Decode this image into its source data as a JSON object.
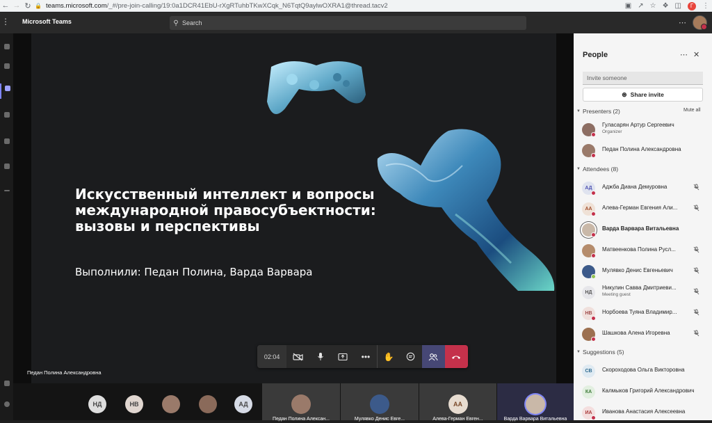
{
  "browser": {
    "url_host": "teams.microsoft.com",
    "url_path": "/_#/pre-join-calling/19:0a1DCR41EbU-rXgRTuhbTKwXCqk_N6TqtQ9aylwOXRA1@thread.tacv2",
    "profile_letter": "Г"
  },
  "teams": {
    "app_title": "Microsoft Teams",
    "search_placeholder": "Search"
  },
  "left_rail": [
    {
      "label": "Activity",
      "icon": "bell-icon"
    },
    {
      "label": "Chat",
      "icon": "chat-icon"
    },
    {
      "label": "Teams",
      "icon": "teams-icon",
      "active": true
    },
    {
      "label": "Assignments",
      "icon": "assignments-icon"
    },
    {
      "label": "Calendar",
      "icon": "calendar-icon"
    },
    {
      "label": "Calls",
      "icon": "phone-icon"
    },
    {
      "label": "...",
      "icon": "more-icon"
    }
  ],
  "slide": {
    "title": "Искусственный интеллект и вопросы международной правосубъектности: вызовы и перспективы",
    "subtitle": "Выполнили: Педан Полина, Варда Варвара"
  },
  "presenter_name": "Педан Полина Александровна",
  "call_controls": {
    "timer": "02:04",
    "buttons": [
      "camera-off-icon",
      "microphone-icon",
      "share-screen-icon",
      "more-icon",
      "raise-hand-icon",
      "chat-icon",
      "people-icon",
      "hang-up-icon"
    ]
  },
  "tiles": {
    "avatars": [
      {
        "initials": "НД",
        "bg": "#dedede",
        "fg": "#444"
      },
      {
        "initials": "НВ",
        "bg": "#e0d6d0",
        "fg": "#444"
      },
      {
        "initials": "",
        "bg": "#9a7a6a",
        "fg": "#fff"
      },
      {
        "initials": "",
        "bg": "#8a6a5a",
        "fg": "#fff"
      },
      {
        "initials": "АД",
        "bg": "#d6dbe6",
        "fg": "#444"
      }
    ],
    "video_tiles": [
      {
        "name": "Педан Полина Алексан...",
        "initials": "",
        "bg": "#9a7a6a"
      },
      {
        "name": "Мулявко Денис Евге...",
        "initials": "",
        "bg": "#3c5a8a"
      },
      {
        "name": "Алева-Герман Евген...",
        "initials": "АА",
        "bg": "#e7dcd0"
      },
      {
        "name": "Варда Варвара Витальевна",
        "initials": "",
        "bg": "#c9b8a8"
      }
    ]
  },
  "people_panel": {
    "title": "People",
    "invite_placeholder": "Invite someone",
    "share_invite": "Share invite",
    "mute_all": "Mute all",
    "presenters_label": "Presenters (2)",
    "attendees_label": "Attendees (8)",
    "suggestions_label": "Suggestions (5)",
    "presenters": [
      {
        "name": "Гуласарян Артур Сергеевич",
        "sub": "Organizer",
        "initials": "",
        "bg": "#8d6e63",
        "status": "#c4314b"
      },
      {
        "name": "Педан Полина Александровна",
        "sub": "",
        "initials": "",
        "bg": "#9a7a6a",
        "status": "#c4314b"
      }
    ],
    "attendees": [
      {
        "name": "Аджба Диана Демуровна",
        "sub": "",
        "initials": "АД",
        "bg": "#dfe3ef",
        "fg": "#4f52b2",
        "status": "#c4314b",
        "mic_off": true
      },
      {
        "name": "Алева-Герман Евгения Али...",
        "sub": "",
        "initials": "АА",
        "bg": "#efe1d6",
        "fg": "#a14d2b",
        "status": "#c4314b",
        "mic_off": true
      },
      {
        "name": "Варда Варвара Витальевна",
        "sub": "",
        "initials": "",
        "bg": "#c9b8a8",
        "status": "#c4314b",
        "bold": true,
        "selected": true
      },
      {
        "name": "Матвеенкова Полина Русл...",
        "sub": "",
        "initials": "",
        "bg": "#b58c6c",
        "status": "#c4314b",
        "mic_off": true
      },
      {
        "name": "Мулявко Денис Евгеньевич",
        "sub": "",
        "initials": "",
        "bg": "#3c5a8a",
        "status": "#92c353",
        "mic_off": true
      },
      {
        "name": "Никулин Савва Дмитриеви...",
        "sub": "Meeting guest",
        "initials": "НД",
        "bg": "#e6e6ea",
        "fg": "#555",
        "status": "",
        "mic_off": true
      },
      {
        "name": "Норбоева Туяна Владимир...",
        "sub": "",
        "initials": "НВ",
        "bg": "#f0e0dc",
        "fg": "#a14d4d",
        "status": "#c4314b",
        "mic_off": true
      },
      {
        "name": "Шашкова Алена Игоревна",
        "sub": "",
        "initials": "",
        "bg": "#9c7050",
        "status": "#c4314b",
        "mic_off": true
      }
    ],
    "suggestions": [
      {
        "name": "Скороходова Ольга Викторовна",
        "initials": "СВ",
        "bg": "#dfeaf2",
        "fg": "#2e6a8e",
        "status": ""
      },
      {
        "name": "Калмыков Григорий Александрович",
        "initials": "КА",
        "bg": "#e2efe0",
        "fg": "#3d7a38",
        "status": ""
      },
      {
        "name": "Иванова Анастасия Алексеевна",
        "initials": "ИА",
        "bg": "#f4dede",
        "fg": "#a83a3a",
        "status": "#c4314b"
      }
    ]
  }
}
